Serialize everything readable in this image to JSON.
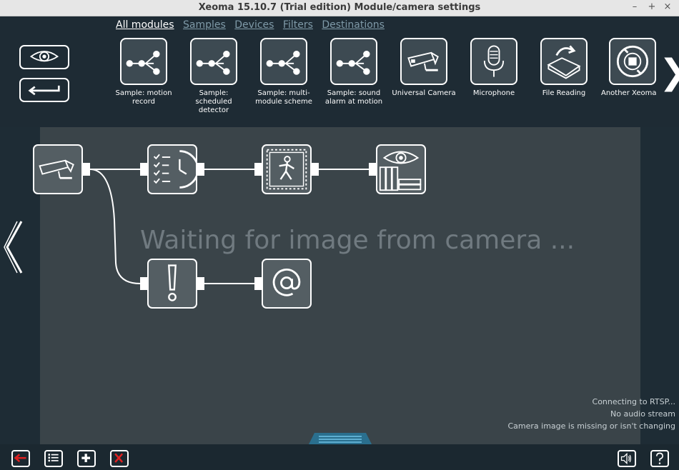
{
  "window": {
    "title": "Xeoma 15.10.7 (Trial edition) Module/camera settings",
    "minimize": "–",
    "maximize": "+",
    "close": "×"
  },
  "tabs": [
    {
      "label": "All modules",
      "active": true
    },
    {
      "label": "Samples",
      "active": false
    },
    {
      "label": "Devices",
      "active": false
    },
    {
      "label": "Filters",
      "active": false
    },
    {
      "label": "Destinations",
      "active": false
    }
  ],
  "modules": [
    {
      "label": "Sample: motion record",
      "icon": "scheme-icon"
    },
    {
      "label": "Sample: scheduled detector",
      "icon": "scheme-icon"
    },
    {
      "label": "Sample: multi-module scheme",
      "icon": "scheme-icon"
    },
    {
      "label": "Sample: sound alarm at motion",
      "icon": "scheme-icon"
    },
    {
      "label": "Universal Camera",
      "icon": "camera-icon"
    },
    {
      "label": "Microphone",
      "icon": "microphone-icon"
    },
    {
      "label": "File Reading",
      "icon": "file-reading-icon"
    },
    {
      "label": "Another Xeoma",
      "icon": "another-xeoma-icon"
    }
  ],
  "canvas": {
    "waiting_text": "Waiting for image from camera ...",
    "nodes": [
      "camera-node",
      "scheduler-node",
      "motion-detector-node",
      "preview-archive-node",
      "problems-detector-node",
      "email-node"
    ]
  },
  "status": {
    "line1": "Connecting to RTSP...",
    "line2": "No audio stream",
    "line3": "Camera image is missing or isn't changing"
  },
  "colors": {
    "background": "#1f2e38",
    "canvas": "#3a4449",
    "node": "#545e63",
    "exit_red": "#e02020"
  }
}
